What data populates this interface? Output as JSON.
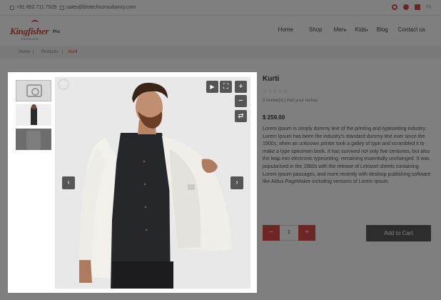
{
  "topbar": {
    "phone": "+91 852 711 7529",
    "email": "sales@bistechconsultancy.com",
    "cart_count": "(0)"
  },
  "logo": {
    "brand": "Kingfisher",
    "pro": "Pro",
    "tagline": "FASHION"
  },
  "nav": {
    "items": [
      "Home",
      "Shop",
      "Men",
      "Kids",
      "Blog",
      "Contact us"
    ]
  },
  "breadcrumb": {
    "items": [
      "Home",
      "Products",
      "Kurti"
    ]
  },
  "product": {
    "title": "Kurti",
    "stars": "☆☆☆☆☆",
    "reviews": "0 review(s) | Add your review",
    "price": "$ 259.00",
    "description": "Lorem Ipsum is simply dummy text of the printing and typesetting industry. Lorem Ipsum has been the industry's standard dummy text ever since the 1500s, when an unknown printer took a galley of type and scrambled it to make a type specimen book. It has survived not only five centuries, but also the leap into electronic typesetting, remaining essentially unchanged. It was popularised in the 1960s with the release of Letraset sheets containing Lorem Ipsum passages, and more recently with desktop publishing software like Aldus PageMaker including versions of Lorem Ipsum.",
    "qty_minus": "−",
    "qty_value": "1",
    "qty_plus": "+",
    "add_to_cart": "Add to Cart"
  },
  "lightbox": {
    "play": "▶",
    "fullscreen": "⛶",
    "zoom_in": "+",
    "zoom_out": "−",
    "swap": "⇄",
    "prev": "‹",
    "next": "›"
  },
  "colors": {
    "accent": "#d9433b",
    "button_dark": "#555555",
    "overlay": "rgba(0,0,0,0.5)"
  }
}
